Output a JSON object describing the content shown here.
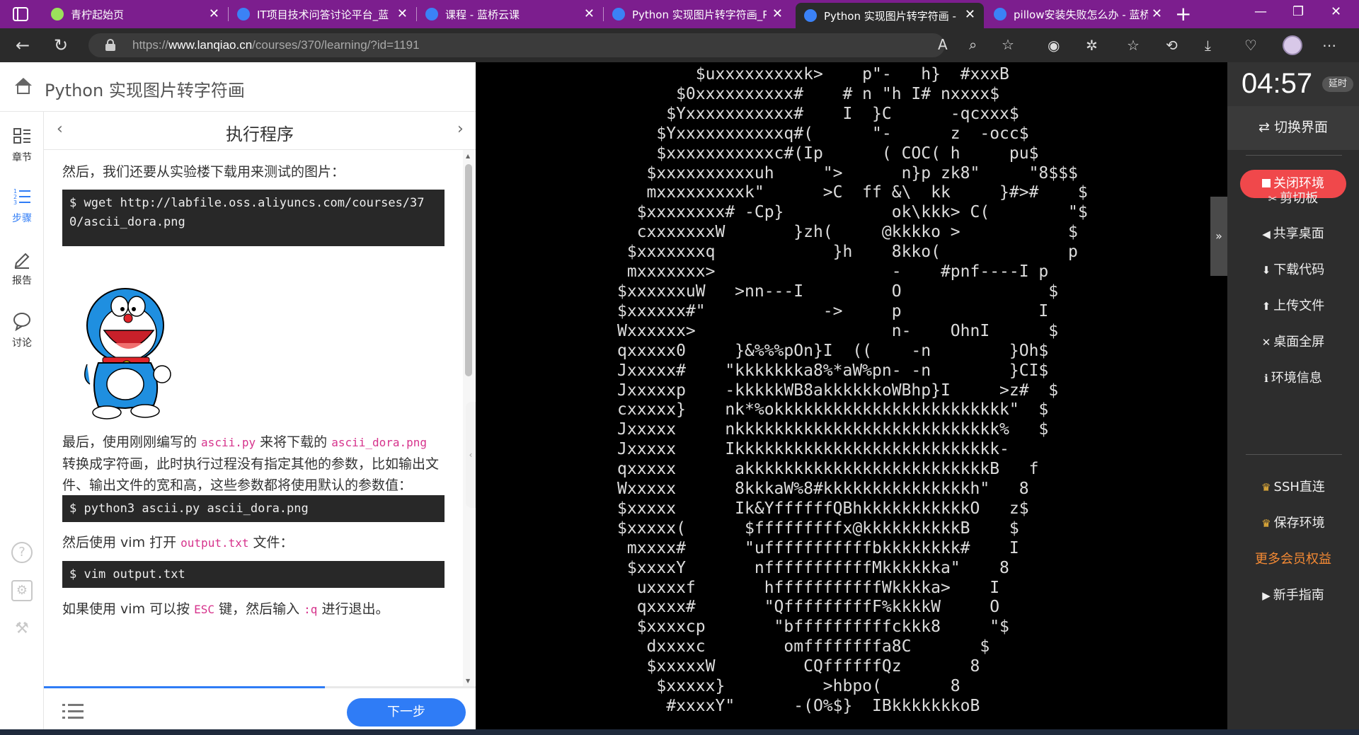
{
  "browser": {
    "tabs": [
      {
        "label": "青柠起始页",
        "favicon_color": "#9be25b"
      },
      {
        "label": "IT项目技术问答讨论平台_蓝",
        "favicon_color": "#3b82f6"
      },
      {
        "label": "课程 - 蓝桥云课",
        "favicon_color": "#3b82f6"
      },
      {
        "label": "Python 实现图片转字符画_P",
        "favicon_color": "#3b82f6"
      },
      {
        "label": "Python 实现图片转字符画 -",
        "favicon_color": "#3b82f6",
        "active": true
      },
      {
        "label": "pillow安装失败怎么办 - 蓝桥",
        "favicon_color": "#3b82f6"
      }
    ],
    "url_prefix": "https://",
    "url_host": "www.lanqiao.cn",
    "url_path": "/courses/370/learning/?id=1191"
  },
  "course": {
    "title": "Python 实现图片转字符画",
    "step_title": "执行程序",
    "nav": [
      {
        "label": "章节",
        "icon": "chapters-icon"
      },
      {
        "label": "步骤",
        "icon": "steps-icon"
      },
      {
        "label": "报告",
        "icon": "report-icon"
      },
      {
        "label": "讨论",
        "icon": "discussion-icon"
      }
    ],
    "progress_fraction": 0.65,
    "next_label": "下一步"
  },
  "article": {
    "p1": "然后，我们还要从实验楼下载用来测试的图片：",
    "code1": "$ wget http://labfile.oss.aliyuncs.com/courses/370/ascii_dora.png",
    "p2_a": "最后，使用刚刚编写的 ",
    "p2_code1": "ascii.py",
    "p2_b": " 来将下载的 ",
    "p2_code2": "ascii_dora.png",
    "p2_c": " 转换成字符画，此时执行过程没有指定其他的参数，比如输出文件、输出文件的宽和高，这些参数都将使用默认的参数值：",
    "code2": "$ python3 ascii.py ascii_dora.png",
    "p3_a": "然后使用 vim 打开 ",
    "p3_code": "output.txt",
    "p3_b": " 文件：",
    "code3": "$ vim output.txt",
    "p4_a": "如果使用 vim 可以按 ",
    "p4_code1": "ESC",
    "p4_b": " 键，然后输入 ",
    "p4_code2": ":q",
    "p4_c": " 进行退出。"
  },
  "terminal": {
    "lines": [
      "        $uxxxxxxxxxk>    p\"-   h}  #xxxB",
      "      $0xxxxxxxxxx#    # n \"h I# nxxxx$",
      "     $Yxxxxxxxxxxx#    I  }C      -qcxxx$",
      "    $Yxxxxxxxxxxxq#(      \"-      z  -occ$",
      "    $xxxxxxxxxxxc#(Ip      ( COC( h     pu$",
      "   $xxxxxxxxxxuh     \">      n}p zk8\"     \"8$$$",
      "   mxxxxxxxxxk\"      >C  ff &\\  kk     }#>#    $",
      "  $xxxxxxxx# -Cp}           ok\\kkk> C(        \"$",
      "  cxxxxxxxW       }zh(     @kkkko >           $",
      " $xxxxxxxq            }h    8kko(             p",
      " mxxxxxxx>                  -    #pnf----I p",
      "$xxxxxxuW   >nn---I         O               $",
      "$xxxxxx#\"            ->     p              I",
      "Wxxxxxx>                    n-    OhnI      $",
      "qxxxxx0     }&%%%pOn}I  ((    -n        }Oh$",
      "Jxxxxx#    \"kkkkkkka8%*aW%pn- -n        }CI$",
      "Jxxxxxp    -kkkkkWB8akkkkkkoWBhp}I     >z#  $",
      "cxxxxx}    nk*%okkkkkkkkkkkkkkkkkkkkkkkk\"  $",
      "Jxxxxx     nkkkkkkkkkkkkkkkkkkkkkkkkkkk%   $",
      "Jxxxxx     Ikkkkkkkkkkkkkkkkkkkkkkkkkkk-",
      "qxxxxx      akkkkkkkkkkkkkkkkkkkkkkkkkB   f",
      "Wxxxxx      8kkkaW%8#kkkkkkkkkkkkkkkh\"   8",
      "$xxxxx      Ik&YffffffQBhkkkkkkkkkkkO   z$",
      "$xxxxx(      $fffffffffx@kkkkkkkkkkB    $",
      " mxxxx#      \"ufffffffffffbkkkkkkkk#    I",
      " $xxxxY       nfffffffffffMkkkkkka\"    8",
      "  uxxxxf       hfffffffffffWkkkka>    I",
      "  qxxxx#       \"QfffffffffF%kkkkW     O",
      "  $xxxxcp       \"bffffffffffckkk8     \"$",
      "   dxxxxc        omffffffffa8C       $",
      "   $xxxxxW         CQffffffQz       8",
      "    $xxxxx}          >hbpo(       8",
      "     #xxxxY\"      -(O%$}  IBkkkkkkkoB"
    ]
  },
  "env_panel": {
    "timer": "04:57",
    "extend_label": "延时",
    "switch_label": "⇄ 切换界面",
    "close_label": "关闭环境",
    "items": [
      {
        "label": "剪切板",
        "icon": "scissors-icon",
        "glyph": "✂"
      },
      {
        "label": "共享桌面",
        "icon": "share-icon",
        "glyph": "◀"
      },
      {
        "label": "下载代码",
        "icon": "download-icon",
        "glyph": "⬇"
      },
      {
        "label": "上传文件",
        "icon": "upload-icon",
        "glyph": "⬆"
      },
      {
        "label": "桌面全屏",
        "icon": "fullscreen-icon",
        "glyph": "✕"
      },
      {
        "label": "环境信息",
        "icon": "info-icon",
        "glyph": "ℹ"
      }
    ],
    "vip_items": [
      {
        "label": "SSH直连",
        "icon": "crown-icon",
        "glyph": "♛"
      },
      {
        "label": "保存环境",
        "icon": "crown-icon",
        "glyph": "♛"
      }
    ],
    "more_label": "更多会员权益",
    "guide_label": "新手指南",
    "guide_glyph": "▶"
  },
  "colors": {
    "tabbar": "#7c1e8e",
    "accent_blue": "#2f7cf6",
    "danger_red": "#f0484b",
    "vip_gold": "#f5b93a",
    "vip_orange": "#f58a34"
  }
}
